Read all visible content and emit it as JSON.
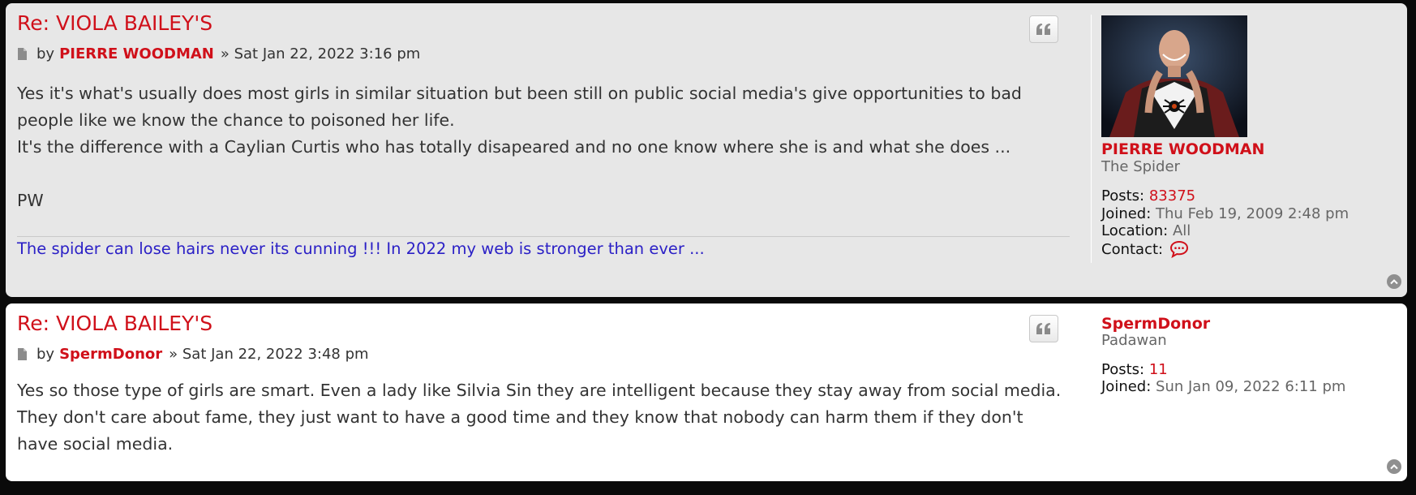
{
  "posts": [
    {
      "title": "Re: VIOLA BAILEY'S",
      "by_label": "by",
      "author": "PIERRE WOODMAN",
      "date": "» Sat Jan 22, 2022 3:16 pm",
      "content": [
        "Yes it's what's usually does most girls in similar situation but been still on public social media's give opportunities to bad people like we know the chance to poisoned her life.",
        "It's the difference with a Caylian Curtis who has totally disapeared and no one know where she is and what she does ..."
      ],
      "closing": "PW",
      "signature": "The spider can lose hairs never its cunning !!! In 2022 my web is stronger than ever ...",
      "profile": {
        "name": "PIERRE WOODMAN",
        "rank": "The Spider",
        "posts_label": "Posts:",
        "posts": "83375",
        "joined_label": "Joined:",
        "joined": "Thu Feb 19, 2009 2:48 pm",
        "location_label": "Location:",
        "location": "All",
        "contact_label": "Contact:"
      }
    },
    {
      "title": "Re: VIOLA BAILEY'S",
      "by_label": "by",
      "author": "SpermDonor",
      "date": "» Sat Jan 22, 2022 3:48 pm",
      "content": [
        "Yes so those type of girls are smart. Even a lady like Silvia Sin they are intelligent because they stay away from social media. They don't care about fame, they just want to have a good time and they know that nobody can harm them if they don't have social media."
      ],
      "profile": {
        "name": "SpermDonor",
        "rank": "Padawan",
        "posts_label": "Posts:",
        "posts": "11",
        "joined_label": "Joined:",
        "joined": "Sun Jan 09, 2022 6:11 pm"
      }
    }
  ],
  "icons": {
    "post": "document-icon",
    "quote": "quote-icon",
    "contact": "speech-bubble-icon",
    "top": "chevron-up-icon"
  },
  "colors": {
    "accent": "#d0101a",
    "signature": "#2b20c6",
    "post_bg_alt": "#e7e7e7"
  }
}
